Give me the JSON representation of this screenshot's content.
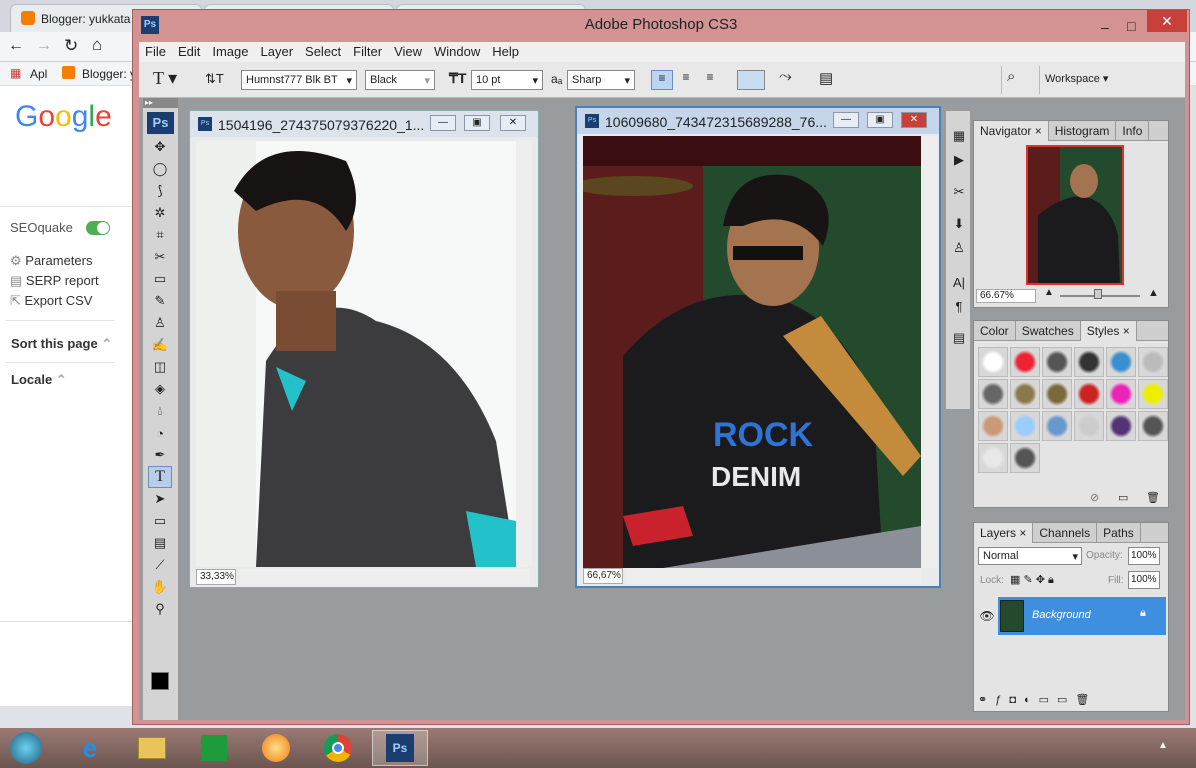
{
  "browser": {
    "tabs": [
      "Blogger: yukkata"
    ],
    "bookmarks": [
      "Apl",
      "Blogger: y"
    ]
  },
  "google": {
    "logo": "Google",
    "seoquake": "SEOquake",
    "menu": [
      "Parameters",
      "SERP report",
      "Export CSV"
    ],
    "sort": "Sort this page",
    "locale": "Locale"
  },
  "ps": {
    "title": "Adobe Photoshop CS3",
    "logo": "Ps",
    "menu": [
      "File",
      "Edit",
      "Image",
      "Layer",
      "Select",
      "Filter",
      "View",
      "Window",
      "Help"
    ],
    "options": {
      "font_family": "Humnst777 Blk BT",
      "font_style": "Black",
      "font_size": "10 pt",
      "aa_label": "a",
      "antialias": "Sharp",
      "workspace": "Workspace"
    },
    "docs": [
      {
        "title": "1504196_274375079376220_1...",
        "zoom": "33,33%"
      },
      {
        "title": "10609680_743472315689288_76...",
        "zoom": "66,67%"
      }
    ],
    "navigator": {
      "tabs": [
        "Navigator",
        "Histogram",
        "Info"
      ],
      "zoom": "66.67%"
    },
    "styles": {
      "tabs": [
        "Color",
        "Swatches",
        "Styles"
      ]
    },
    "layers": {
      "tabs": [
        "Layers",
        "Channels",
        "Paths"
      ],
      "blend": "Normal",
      "opacity_label": "Opacity:",
      "opacity": "100%",
      "lock_label": "Lock:",
      "fill_label": "Fill:",
      "fill": "100%",
      "layer_name": "Background"
    }
  },
  "colors": {
    "ps_frame": "#d29392",
    "accent": "#3f8fe0"
  }
}
